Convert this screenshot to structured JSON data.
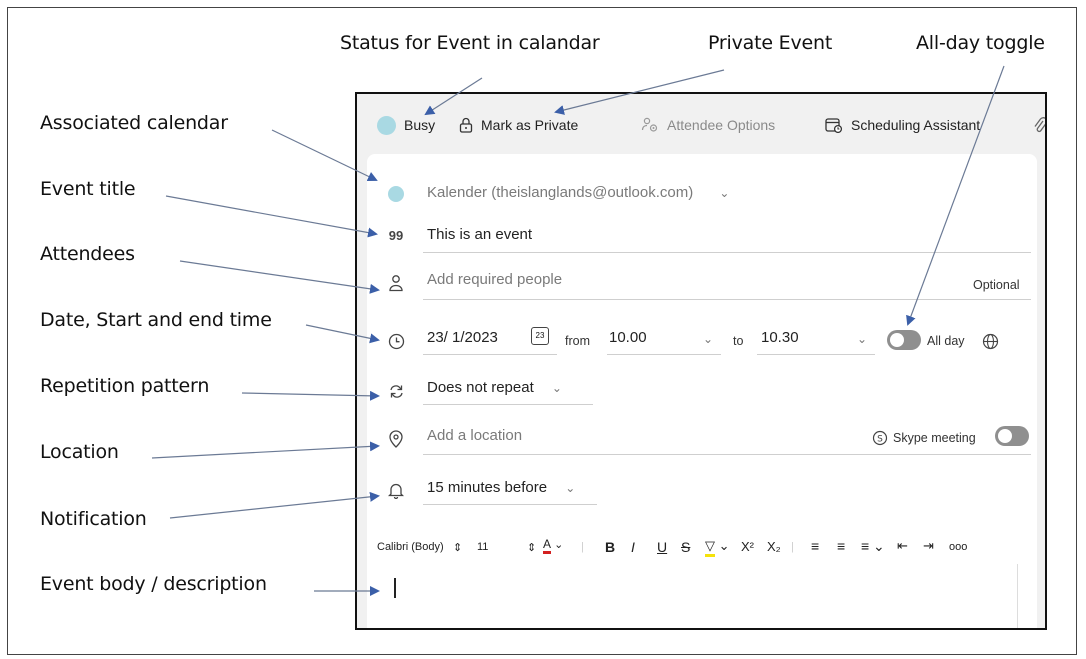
{
  "annotations": {
    "status": "Status for Event in calandar",
    "private": "Private Event",
    "allday": "All-day toggle",
    "calendar": "Associated calendar",
    "title": "Event title",
    "attendees": "Attendees",
    "datetime": "Date, Start and end time",
    "repetition": "Repetition pattern",
    "location": "Location",
    "notification": "Notification",
    "body": "Event body / description"
  },
  "toolbar": {
    "busy": "Busy",
    "private": "Mark as Private",
    "attendee_options": "Attendee Options",
    "scheduling": "Scheduling Assistant"
  },
  "form": {
    "calendar": "Kalender (theislanglands@outlook.com)",
    "title": "This is an event",
    "attendees_placeholder": "Add required people",
    "optional": "Optional",
    "date": "23/ 1/2023",
    "calendar_badge": "23",
    "from_label": "from",
    "start_time": "10.00",
    "to_label": "to",
    "end_time": "10.30",
    "allday_label": "All day",
    "repeat": "Does not repeat",
    "location_placeholder": "Add a location",
    "skype": "Skype meeting",
    "reminder": "15 minutes before"
  },
  "format": {
    "font": "Calibri (Body)",
    "size": "11",
    "bold": "B",
    "italic": "I",
    "underline": "U",
    "strike": "S",
    "superscript": "X²",
    "subscript": "X₂",
    "more": "ooo"
  },
  "colors": {
    "accent_dot": "#a9d9e3",
    "arrow": "#3b5fa8"
  }
}
